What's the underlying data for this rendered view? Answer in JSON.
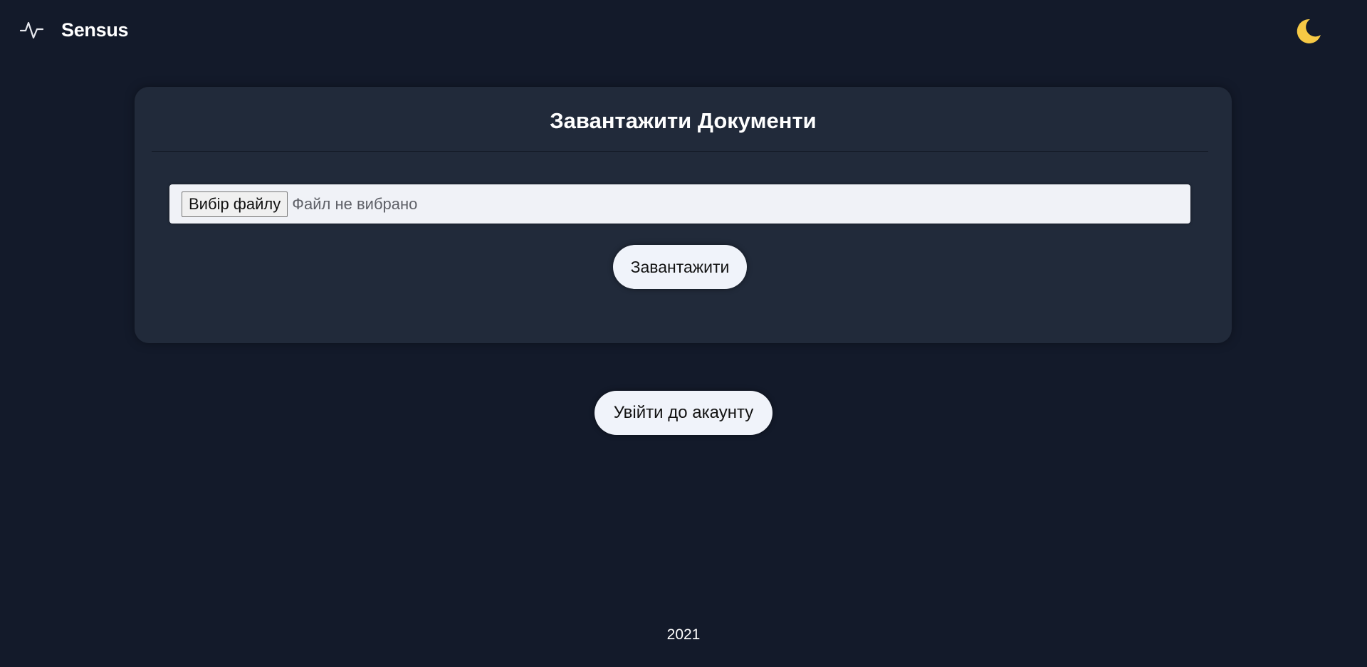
{
  "header": {
    "brand": "Sensus",
    "logo_icon": "pulse-icon",
    "theme_icon": "moon-icon",
    "theme_icon_color": "#f6c945"
  },
  "upload_card": {
    "title": "Завантажити Документи",
    "file_input": {
      "button_label": "Вибір файлу",
      "status_text": "Файл не вибрано"
    },
    "submit_label": "Завантажити"
  },
  "login": {
    "label": "Увійти до акаунту"
  },
  "footer": {
    "year": "2021"
  },
  "colors": {
    "background": "#131a2a",
    "card": "#212a3a",
    "button": "#f0f3fa"
  }
}
